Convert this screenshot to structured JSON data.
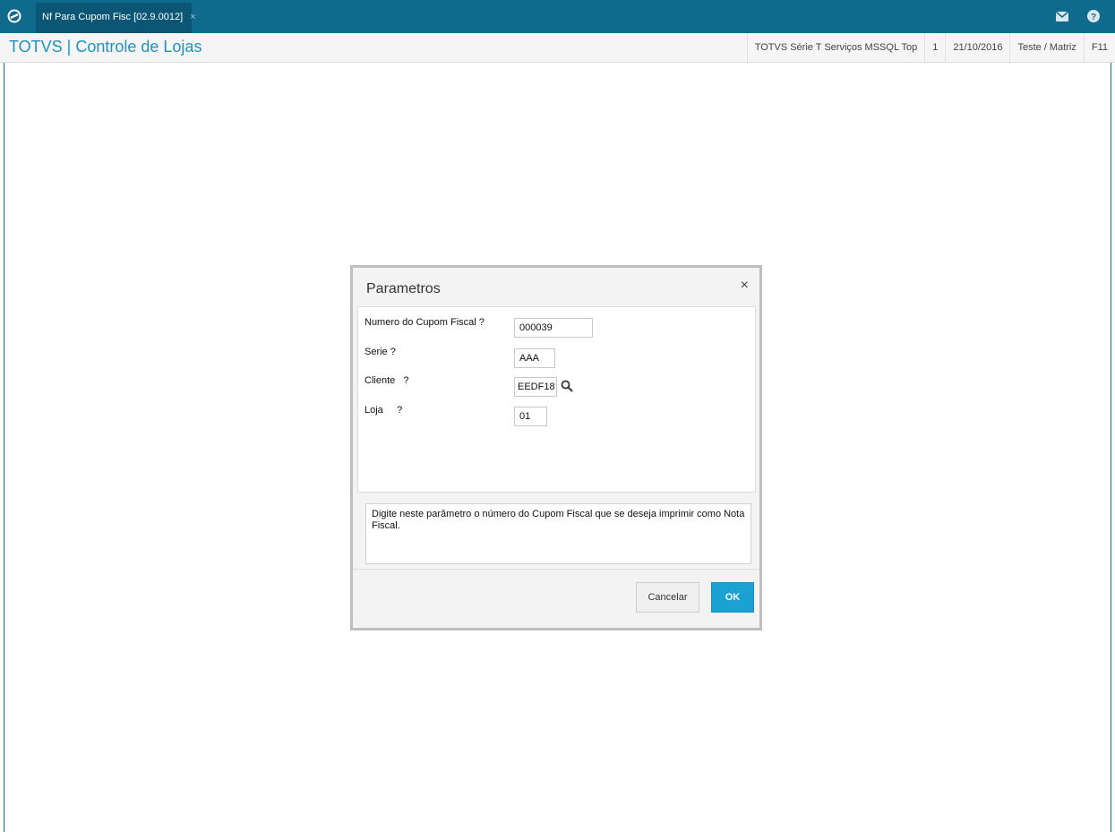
{
  "topbar": {
    "tab_label": "Nf Para Cupom Fisc [02.9.0012]",
    "tab_close": "×",
    "colors": {
      "bar": "#0f6b8e",
      "active_tab": "#0c5675"
    }
  },
  "header": {
    "app_title": "TOTVS | Controle de Lojas",
    "environment": "TOTVS Série T Serviços MSSQL Top",
    "company_number": "1",
    "date": "21/10/2016",
    "branch": "Teste / Matriz",
    "shortcut": "F11"
  },
  "dialog": {
    "title": "Parametros",
    "close": "×",
    "fields": [
      {
        "label": "Numero do Cupom Fiscal ?",
        "value": "000039"
      },
      {
        "label": "Serie ?",
        "value": "AAA"
      },
      {
        "label": "Cliente   ?",
        "value": "EEDF18"
      },
      {
        "label": "Loja     ?",
        "value": "01"
      }
    ],
    "help_text": "Digite neste parâmetro o número do Cupom Fiscal que se deseja imprimir como Nota Fiscal.",
    "buttons": {
      "cancel": "Cancelar",
      "ok": "OK"
    },
    "colors": {
      "ok_button": "#1ba1d2",
      "title_accent": "#1d93bd"
    }
  }
}
